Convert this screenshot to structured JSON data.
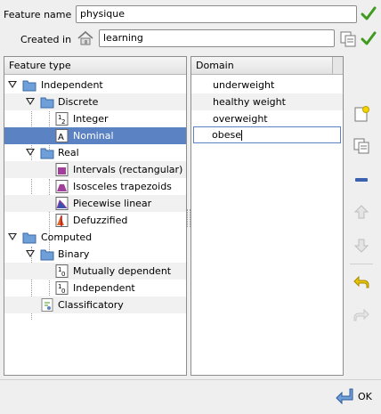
{
  "form": {
    "feature_name_label": "Feature name",
    "feature_name_value": "physique",
    "created_in_label": "Created in",
    "created_in_value": "learning"
  },
  "tree": {
    "header": "Feature type",
    "rows": [
      {
        "label": "Independent"
      },
      {
        "label": "Discrete"
      },
      {
        "label": "Integer"
      },
      {
        "label": "Nominal"
      },
      {
        "label": "Real"
      },
      {
        "label": "Intervals (rectangular)"
      },
      {
        "label": "Isosceles trapezoids"
      },
      {
        "label": "Piecewise linear"
      },
      {
        "label": "Defuzzified"
      },
      {
        "label": "Computed"
      },
      {
        "label": "Binary"
      },
      {
        "label": "Mutually dependent"
      },
      {
        "label": "Independent"
      },
      {
        "label": "Classificatory"
      }
    ],
    "selected": "Nominal"
  },
  "domain": {
    "header": "Domain",
    "items": [
      "underweight",
      "healthy weight",
      "overweight"
    ],
    "editing_value": "obese"
  },
  "footer": {
    "ok_label": "OK"
  },
  "colors": {
    "selection": "#5b82c3",
    "check_green": "#3f9a1f",
    "minus_blue": "#3a62b0",
    "undo_yellow": "#d9b400"
  }
}
